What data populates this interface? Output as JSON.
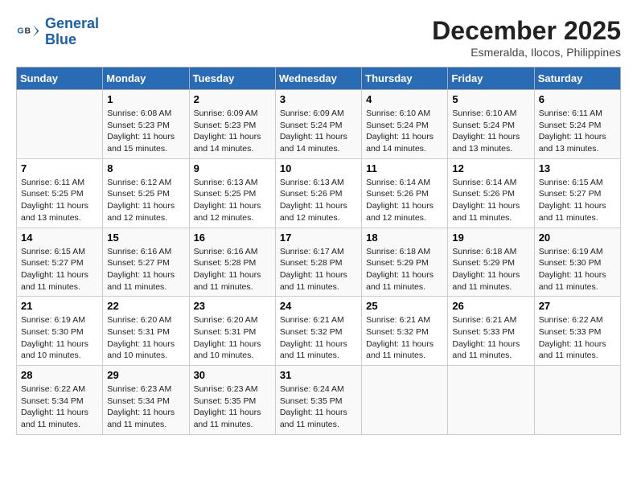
{
  "header": {
    "logo_line1": "General",
    "logo_line2": "Blue",
    "month_year": "December 2025",
    "location": "Esmeralda, Ilocos, Philippines"
  },
  "days_of_week": [
    "Sunday",
    "Monday",
    "Tuesday",
    "Wednesday",
    "Thursday",
    "Friday",
    "Saturday"
  ],
  "weeks": [
    [
      {
        "num": "",
        "detail": ""
      },
      {
        "num": "1",
        "detail": "Sunrise: 6:08 AM\nSunset: 5:23 PM\nDaylight: 11 hours\nand 15 minutes."
      },
      {
        "num": "2",
        "detail": "Sunrise: 6:09 AM\nSunset: 5:23 PM\nDaylight: 11 hours\nand 14 minutes."
      },
      {
        "num": "3",
        "detail": "Sunrise: 6:09 AM\nSunset: 5:24 PM\nDaylight: 11 hours\nand 14 minutes."
      },
      {
        "num": "4",
        "detail": "Sunrise: 6:10 AM\nSunset: 5:24 PM\nDaylight: 11 hours\nand 14 minutes."
      },
      {
        "num": "5",
        "detail": "Sunrise: 6:10 AM\nSunset: 5:24 PM\nDaylight: 11 hours\nand 13 minutes."
      },
      {
        "num": "6",
        "detail": "Sunrise: 6:11 AM\nSunset: 5:24 PM\nDaylight: 11 hours\nand 13 minutes."
      }
    ],
    [
      {
        "num": "7",
        "detail": "Sunrise: 6:11 AM\nSunset: 5:25 PM\nDaylight: 11 hours\nand 13 minutes."
      },
      {
        "num": "8",
        "detail": "Sunrise: 6:12 AM\nSunset: 5:25 PM\nDaylight: 11 hours\nand 12 minutes."
      },
      {
        "num": "9",
        "detail": "Sunrise: 6:13 AM\nSunset: 5:25 PM\nDaylight: 11 hours\nand 12 minutes."
      },
      {
        "num": "10",
        "detail": "Sunrise: 6:13 AM\nSunset: 5:26 PM\nDaylight: 11 hours\nand 12 minutes."
      },
      {
        "num": "11",
        "detail": "Sunrise: 6:14 AM\nSunset: 5:26 PM\nDaylight: 11 hours\nand 12 minutes."
      },
      {
        "num": "12",
        "detail": "Sunrise: 6:14 AM\nSunset: 5:26 PM\nDaylight: 11 hours\nand 11 minutes."
      },
      {
        "num": "13",
        "detail": "Sunrise: 6:15 AM\nSunset: 5:27 PM\nDaylight: 11 hours\nand 11 minutes."
      }
    ],
    [
      {
        "num": "14",
        "detail": "Sunrise: 6:15 AM\nSunset: 5:27 PM\nDaylight: 11 hours\nand 11 minutes."
      },
      {
        "num": "15",
        "detail": "Sunrise: 6:16 AM\nSunset: 5:27 PM\nDaylight: 11 hours\nand 11 minutes."
      },
      {
        "num": "16",
        "detail": "Sunrise: 6:16 AM\nSunset: 5:28 PM\nDaylight: 11 hours\nand 11 minutes."
      },
      {
        "num": "17",
        "detail": "Sunrise: 6:17 AM\nSunset: 5:28 PM\nDaylight: 11 hours\nand 11 minutes."
      },
      {
        "num": "18",
        "detail": "Sunrise: 6:18 AM\nSunset: 5:29 PM\nDaylight: 11 hours\nand 11 minutes."
      },
      {
        "num": "19",
        "detail": "Sunrise: 6:18 AM\nSunset: 5:29 PM\nDaylight: 11 hours\nand 11 minutes."
      },
      {
        "num": "20",
        "detail": "Sunrise: 6:19 AM\nSunset: 5:30 PM\nDaylight: 11 hours\nand 11 minutes."
      }
    ],
    [
      {
        "num": "21",
        "detail": "Sunrise: 6:19 AM\nSunset: 5:30 PM\nDaylight: 11 hours\nand 10 minutes."
      },
      {
        "num": "22",
        "detail": "Sunrise: 6:20 AM\nSunset: 5:31 PM\nDaylight: 11 hours\nand 10 minutes."
      },
      {
        "num": "23",
        "detail": "Sunrise: 6:20 AM\nSunset: 5:31 PM\nDaylight: 11 hours\nand 10 minutes."
      },
      {
        "num": "24",
        "detail": "Sunrise: 6:21 AM\nSunset: 5:32 PM\nDaylight: 11 hours\nand 11 minutes."
      },
      {
        "num": "25",
        "detail": "Sunrise: 6:21 AM\nSunset: 5:32 PM\nDaylight: 11 hours\nand 11 minutes."
      },
      {
        "num": "26",
        "detail": "Sunrise: 6:21 AM\nSunset: 5:33 PM\nDaylight: 11 hours\nand 11 minutes."
      },
      {
        "num": "27",
        "detail": "Sunrise: 6:22 AM\nSunset: 5:33 PM\nDaylight: 11 hours\nand 11 minutes."
      }
    ],
    [
      {
        "num": "28",
        "detail": "Sunrise: 6:22 AM\nSunset: 5:34 PM\nDaylight: 11 hours\nand 11 minutes."
      },
      {
        "num": "29",
        "detail": "Sunrise: 6:23 AM\nSunset: 5:34 PM\nDaylight: 11 hours\nand 11 minutes."
      },
      {
        "num": "30",
        "detail": "Sunrise: 6:23 AM\nSunset: 5:35 PM\nDaylight: 11 hours\nand 11 minutes."
      },
      {
        "num": "31",
        "detail": "Sunrise: 6:24 AM\nSunset: 5:35 PM\nDaylight: 11 hours\nand 11 minutes."
      },
      {
        "num": "",
        "detail": ""
      },
      {
        "num": "",
        "detail": ""
      },
      {
        "num": "",
        "detail": ""
      }
    ]
  ]
}
